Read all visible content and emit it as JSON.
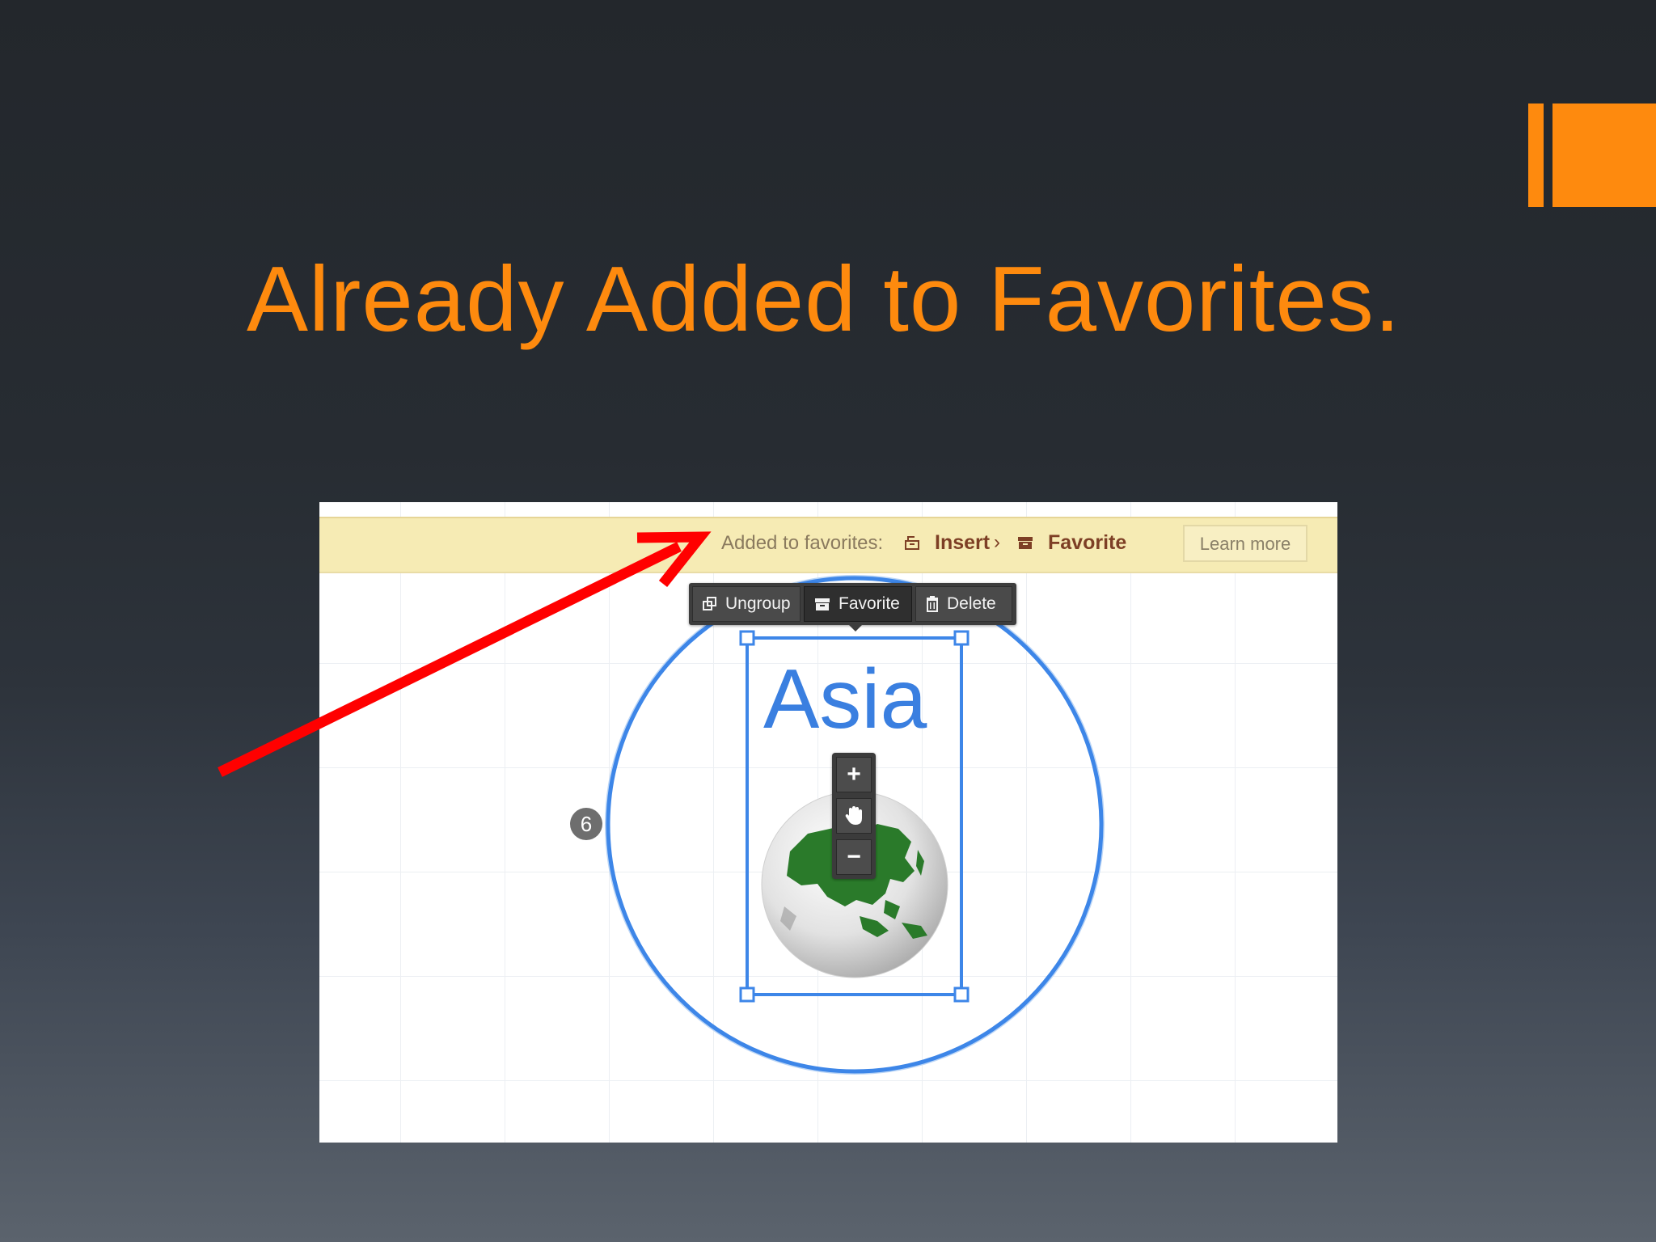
{
  "slide": {
    "title": "Already Added to Favorites.",
    "accent_color": "#fe8a0e"
  },
  "screenshot": {
    "notice_bar": {
      "text": "Added to favorites:",
      "insert_icon": "insert-icon",
      "insert_link": "Insert",
      "separator": "›",
      "favorite_icon": "favorite-box-icon",
      "favorite_link": "Favorite",
      "learn_more": "Learn more"
    },
    "toolbar": {
      "ungroup": "Ungroup",
      "favorite": "Favorite",
      "delete": "Delete"
    },
    "step_badge": "6",
    "object": {
      "label": "Asia",
      "label_color": "#3a7fe0",
      "image": "asia-globe"
    },
    "zoom": {
      "plus": "+",
      "hand_icon": "hand-icon",
      "minus": "−"
    }
  },
  "annotation": {
    "arrow_color": "#ff0000"
  }
}
